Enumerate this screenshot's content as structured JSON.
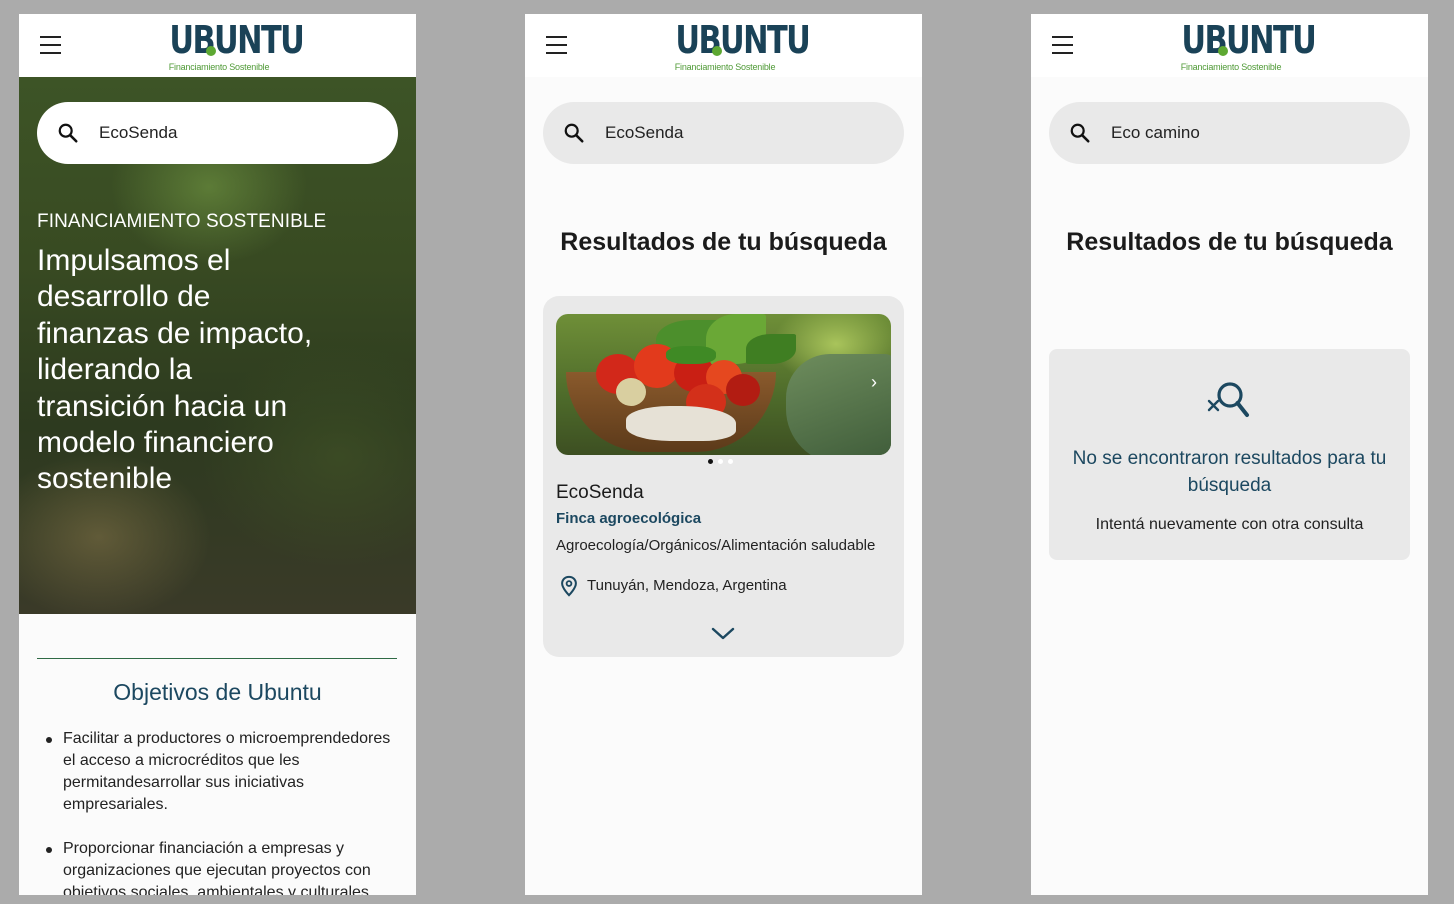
{
  "brand": {
    "name": "UBUNTU",
    "tagline": "Financiamiento Sostenible",
    "primary_color": "#1a4257",
    "accent_color": "#5da832"
  },
  "icons": {
    "menu": "hamburger-menu-icon",
    "search": "magnifier-icon",
    "pin": "location-pin-icon",
    "expand": "chevron-down-icon",
    "no_results": "search-x-icon"
  },
  "screen1": {
    "search_value": "EcoSenda",
    "hero": {
      "kicker": "FINANCIAMIENTO SOSTENIBLE",
      "title": "Impulsamos el desarrollo de finanzas de impacto, liderando la transición hacia un modelo financiero sostenible"
    },
    "objectives": {
      "title": "Objetivos de Ubuntu",
      "items": [
        "Facilitar a productores o microemprendedores el acceso a microcréditos que les permitandesarrollar sus iniciativas empresariales.",
        "Proporcionar financiación a empresas y organizaciones que ejecutan proyectos con objetivos sociales, ambientales y culturales."
      ]
    }
  },
  "screen2": {
    "search_value": "EcoSenda",
    "results_title": "Resultados de tu búsqueda",
    "result": {
      "name": "EcoSenda",
      "type": "Finca agroecológica",
      "tags": "Agroecología/Orgánicos/Alimentación saludable",
      "location": "Tunuyán, Mendoza, Argentina",
      "image_slides": 3,
      "active_slide": 1
    }
  },
  "screen3": {
    "search_value": "Eco camino",
    "results_title": "Resultados de tu búsqueda",
    "empty_title": "No se encontraron resultados para tu búsqueda",
    "empty_subtitle": "Intentá nuevamente con otra consulta"
  }
}
